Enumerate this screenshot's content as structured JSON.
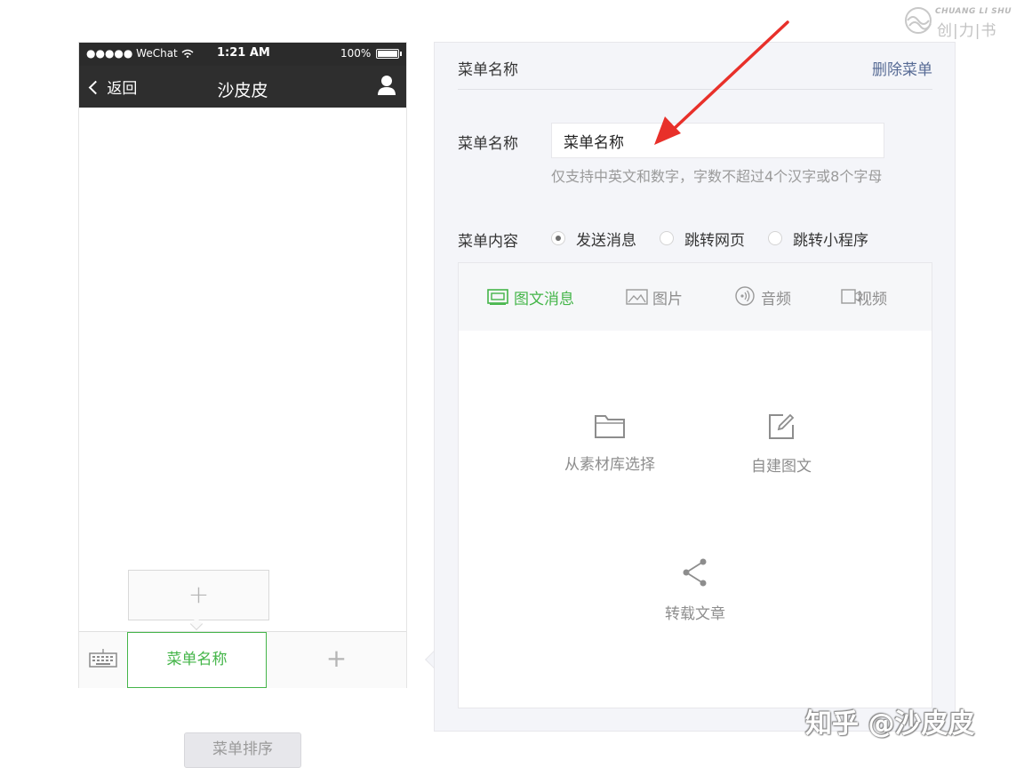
{
  "watermark": {
    "latin": "CHUANG LI SHU",
    "chinese": "创|力|书"
  },
  "phone": {
    "status": {
      "left": "●●●●● WeChat",
      "time": "1:21 AM",
      "battery": "100%"
    },
    "nav": {
      "back_label": "返回",
      "title": "沙皮皮"
    },
    "menu": {
      "current_item": "菜单名称"
    }
  },
  "sort_button": "菜单排序",
  "editor": {
    "header_title": "菜单名称",
    "delete_label": "删除菜单",
    "name_label": "菜单名称",
    "name_value": "菜单名称",
    "name_hint": "仅支持中英文和数字，字数不超过4个汉字或8个字母",
    "content_label": "菜单内容",
    "content_options": [
      {
        "label": "发送消息",
        "selected": true
      },
      {
        "label": "跳转网页",
        "selected": false
      },
      {
        "label": "跳转小程序",
        "selected": false
      }
    ],
    "tabs": [
      {
        "label": "图文消息",
        "icon": "news-icon",
        "active": true
      },
      {
        "label": "图片",
        "icon": "image-icon",
        "active": false
      },
      {
        "label": "音频",
        "icon": "audio-icon",
        "active": false
      },
      {
        "label": "视频",
        "icon": "video-icon",
        "active": false
      }
    ],
    "actions": {
      "from_library": "从素材库选择",
      "create_news": "自建图文",
      "repost": "转载文章"
    }
  },
  "colors": {
    "accent": "#44b549",
    "link": "#576b95",
    "annotation_arrow": "#e8302a"
  },
  "overlay_watermark": "知乎 @沙皮皮"
}
